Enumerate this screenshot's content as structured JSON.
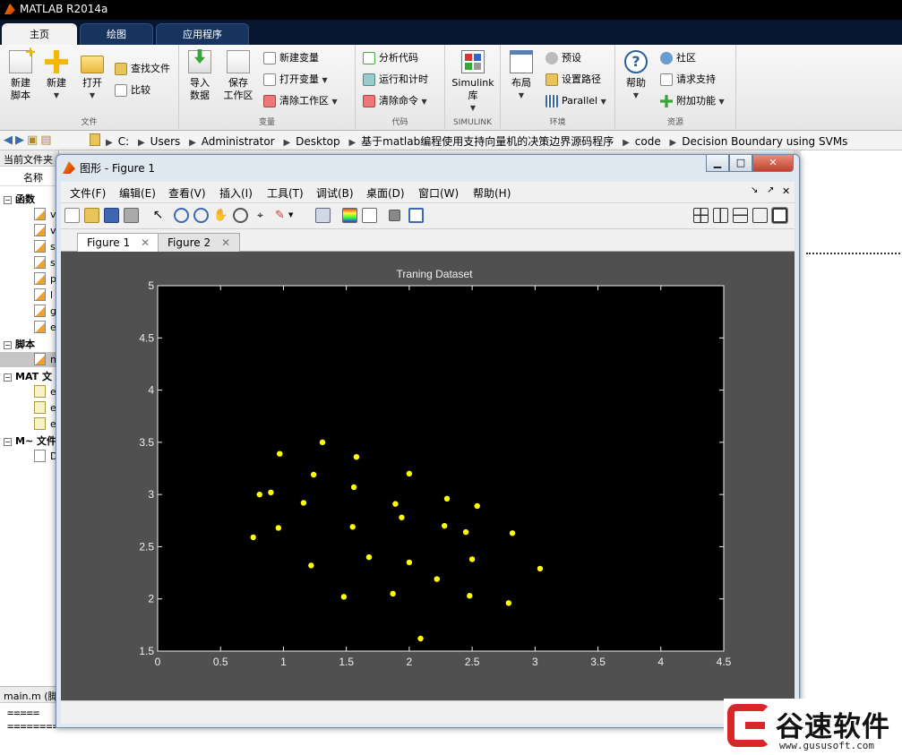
{
  "app": {
    "title": "MATLAB R2014a"
  },
  "ribbon_tabs": [
    {
      "label": "主页",
      "active": true
    },
    {
      "label": "绘图",
      "active": false
    },
    {
      "label": "应用程序",
      "active": false
    }
  ],
  "ribbon": {
    "file": {
      "new_script": "新建\n脚本",
      "new": "新建",
      "open": "打开",
      "find_files": "查找文件",
      "compare": "比较",
      "group": "文件"
    },
    "variable": {
      "import": "导入\n数据",
      "save_ws": "保存\n工作区",
      "new_var": "新建变量",
      "open_var": "打开变量",
      "clear_ws": "清除工作区",
      "group": "变量"
    },
    "code": {
      "analyze": "分析代码",
      "run_time": "运行和计时",
      "clear_cmd": "清除命令",
      "group": "代码"
    },
    "simulink": {
      "lib": "Simulink\n库",
      "group": "SIMULINK"
    },
    "env": {
      "layout": "布局",
      "prefs": "预设",
      "set_path": "设置路径",
      "parallel": "Parallel",
      "group": "环境"
    },
    "resources": {
      "help": "帮助",
      "community": "社区",
      "support": "请求支持",
      "addons": "附加功能",
      "group": "资源"
    }
  },
  "address": {
    "crumbs": [
      "C:",
      "Users",
      "Administrator",
      "Desktop",
      "基于matlab编程使用支持向量机的决策边界源码程序",
      "code",
      "Decision Boundary using SVMs"
    ]
  },
  "left_panel": {
    "header": "当前文件夹",
    "col": "名称",
    "sections": [
      {
        "label": "函数",
        "items": [
          "v",
          "v",
          "s",
          "s",
          "p",
          "l",
          "g",
          "e"
        ]
      },
      {
        "label": "脚本",
        "items": [
          "n"
        ]
      },
      {
        "label": "MAT 文",
        "items": [
          "e",
          "e",
          "e"
        ]
      },
      {
        "label": "M~ 文件",
        "items": [
          "D"
        ]
      }
    ]
  },
  "editor": {
    "tab": "main.m (脚",
    "line1": "=====",
    "line2": "==================="
  },
  "figure": {
    "title": "图形 - Figure 1",
    "menu": [
      "文件(F)",
      "编辑(E)",
      "查看(V)",
      "插入(I)",
      "工具(T)",
      "调试(B)",
      "桌面(D)",
      "窗口(W)",
      "帮助(H)"
    ],
    "tabs": [
      {
        "label": "Figure 1",
        "active": true
      },
      {
        "label": "Figure 2",
        "active": false
      }
    ],
    "colors": {
      "axes_bg": "#000000",
      "figure_bg": "#505050",
      "marker": "#ffff00"
    }
  },
  "chart_data": {
    "type": "scatter",
    "title": "Traning Dataset",
    "xlabel": "",
    "ylabel": "",
    "xlim": [
      0,
      4.5
    ],
    "ylim": [
      1.5,
      5
    ],
    "xticks": [
      "0",
      "0.5",
      "1",
      "1.5",
      "2",
      "2.5",
      "3",
      "3.5",
      "4",
      "4.5"
    ],
    "yticks": [
      "1.5",
      "2",
      "2.5",
      "3",
      "3.5",
      "4",
      "4.5",
      "5"
    ],
    "grid": false,
    "points": [
      [
        0.76,
        2.59
      ],
      [
        0.81,
        3.0
      ],
      [
        0.9,
        3.02
      ],
      [
        0.96,
        2.68
      ],
      [
        0.97,
        3.39
      ],
      [
        1.16,
        2.92
      ],
      [
        1.22,
        2.32
      ],
      [
        1.24,
        3.19
      ],
      [
        1.31,
        3.5
      ],
      [
        1.48,
        2.02
      ],
      [
        1.55,
        2.69
      ],
      [
        1.56,
        3.07
      ],
      [
        1.58,
        3.36
      ],
      [
        1.68,
        2.4
      ],
      [
        1.87,
        2.05
      ],
      [
        1.89,
        2.91
      ],
      [
        1.94,
        2.78
      ],
      [
        2.0,
        3.2
      ],
      [
        2.0,
        2.35
      ],
      [
        2.09,
        1.62
      ],
      [
        2.22,
        2.19
      ],
      [
        2.28,
        2.7
      ],
      [
        2.3,
        2.96
      ],
      [
        2.45,
        2.64
      ],
      [
        2.48,
        2.03
      ],
      [
        2.5,
        2.38
      ],
      [
        2.54,
        2.89
      ],
      [
        2.79,
        1.96
      ],
      [
        2.82,
        2.63
      ],
      [
        3.04,
        2.29
      ]
    ]
  },
  "watermark": {
    "brand": "谷速软件",
    "url": "www.gususoft.com"
  }
}
